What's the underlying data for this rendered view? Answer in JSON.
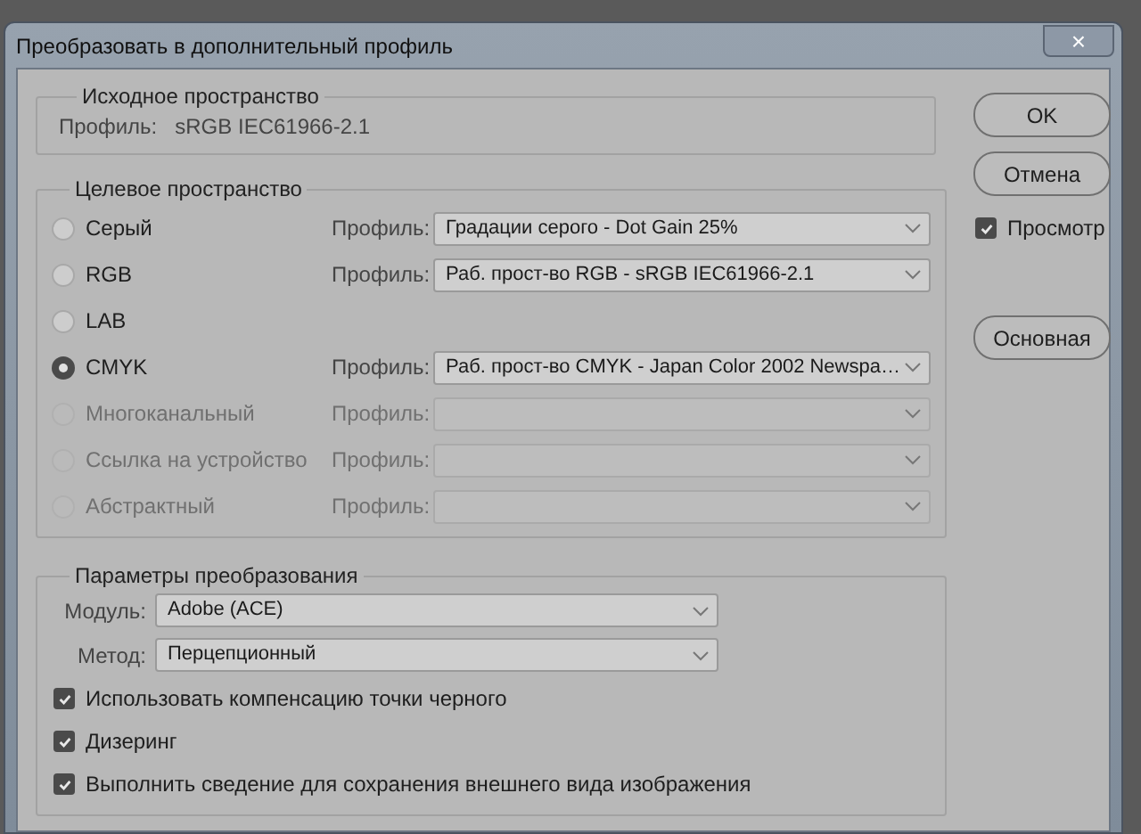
{
  "window": {
    "title": "Преобразовать в дополнительный профиль",
    "close": "×"
  },
  "source": {
    "legend": "Исходное пространство",
    "label": "Профиль:",
    "value": "sRGB IEC61966-2.1"
  },
  "target": {
    "legend": "Целевое пространство",
    "options": [
      {
        "label": "Серый",
        "selected": false,
        "disabled": false,
        "profile_label": "Профиль:",
        "profile": "Градации серого - Dot Gain 25%"
      },
      {
        "label": "RGB",
        "selected": false,
        "disabled": false,
        "profile_label": "Профиль:",
        "profile": "Раб. прост-во RGB - sRGB IEC61966-2.1"
      },
      {
        "label": "LAB",
        "selected": false,
        "disabled": false
      },
      {
        "label": "CMYK",
        "selected": true,
        "disabled": false,
        "profile_label": "Профиль:",
        "profile": "Раб. прост-во CMYK - Japan Color 2002 Newspa…"
      },
      {
        "label": "Многоканальный",
        "selected": false,
        "disabled": true,
        "profile_label": "Профиль:"
      },
      {
        "label": "Ссылка на устройство",
        "selected": false,
        "disabled": true,
        "profile_label": "Профиль:"
      },
      {
        "label": "Абстрактный",
        "selected": false,
        "disabled": true,
        "profile_label": "Профиль:"
      }
    ]
  },
  "conversion": {
    "legend": "Параметры преобразования",
    "fields": [
      {
        "label": "Модуль:",
        "value": "Adobe (ACE)"
      },
      {
        "label": "Метод:",
        "value": "Перцепционный"
      }
    ],
    "options": [
      {
        "label": "Использовать компенсацию точки черного",
        "checked": true
      },
      {
        "label": "Дизеринг",
        "checked": true
      },
      {
        "label": "Выполнить сведение для сохранения внешнего вида изображения",
        "checked": true
      }
    ]
  },
  "buttons": [
    "OK",
    "Отмена"
  ],
  "preview": {
    "label": "Просмотр",
    "checked": true
  },
  "default_button": "Основная"
}
